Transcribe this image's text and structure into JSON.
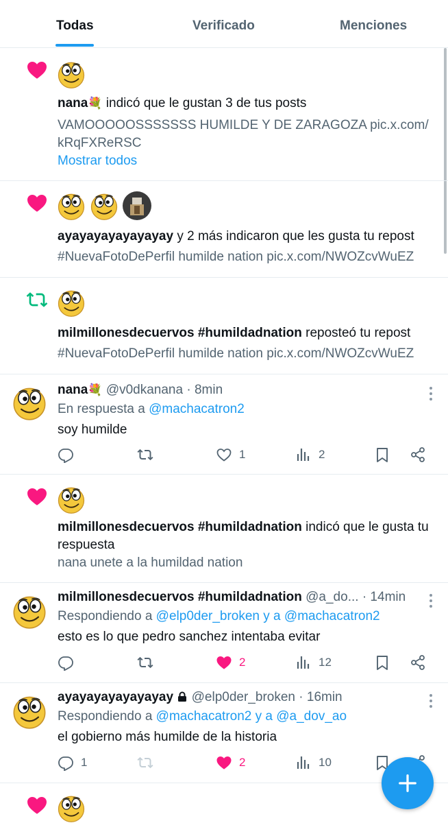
{
  "tabs": [
    {
      "label": "Todas",
      "active": true
    },
    {
      "label": "Verificado",
      "active": false
    },
    {
      "label": "Menciones",
      "active": false
    }
  ],
  "colors": {
    "accent": "#1d9bf0",
    "like": "#f91880",
    "repost": "#00ba7c",
    "text": "#0f1419",
    "secondary": "#536471"
  },
  "notifications": [
    {
      "type": "like",
      "icon": "heart-icon",
      "actor": "nana",
      "actor_emoji": "💐",
      "action": " indicó que le gustan 3 de tus posts",
      "content_line1": "VAMOOOOOSSSSSSS HUMILDE Y DE ZARAGOZA pic.x.com/",
      "content_line2": "kRqFXReRSC",
      "show_all": "Mostrar todos"
    },
    {
      "type": "like",
      "icon": "heart-icon",
      "actor": "ayayayayayayayay",
      "action": " y 2 más indicaron que les gusta tu repost",
      "content": "#NuevaFotoDePerfil humilde nation pic.x.com/NWOZcvWuEZ"
    },
    {
      "type": "repost",
      "icon": "repost-icon",
      "actor": "milmillonesdecuervos #humildadnation",
      "action": " reposteó tu repost",
      "content": "#NuevaFotoDePerfil humilde nation pic.x.com/NWOZcvWuEZ"
    },
    {
      "type": "like",
      "icon": "heart-icon",
      "actor": "milmillonesdecuervos #humildadnation",
      "action": " indicó que le gusta tu respuesta",
      "content": "nana unete a la humildad nation"
    },
    {
      "type": "like",
      "icon": "heart-icon"
    }
  ],
  "posts": [
    {
      "name": "nana",
      "name_emoji": "💐",
      "handle": "@v0dkanana",
      "time": "· 8min",
      "reply_prefix": "En respuesta a ",
      "reply_to": "@machacatron2",
      "text": "soy humilde",
      "replies": "",
      "reposts": "",
      "likes": "1",
      "views": "2",
      "liked": false
    },
    {
      "name": "milmillonesdecuervos #humildadnation",
      "handle": "@a_do...",
      "time": "· 14min",
      "reply_prefix": "Respondiendo a ",
      "reply_to": "@elp0der_broken y a @machacatron2",
      "text": "esto es lo que pedro sanchez intentaba evitar",
      "replies": "",
      "reposts": "",
      "likes": "2",
      "views": "12",
      "liked": true
    },
    {
      "name": "ayayayayayayayay",
      "handle": "@elp0der_broken",
      "time": "· 16min",
      "reply_prefix": "Respondiendo a ",
      "reply_to": "@machacatron2 y a @a_dov_ao",
      "text": "el gobierno más humilde de la historia",
      "replies": "1",
      "reposts": "",
      "likes": "2",
      "views": "10",
      "liked": true
    }
  ],
  "fab": {
    "label": "+"
  }
}
